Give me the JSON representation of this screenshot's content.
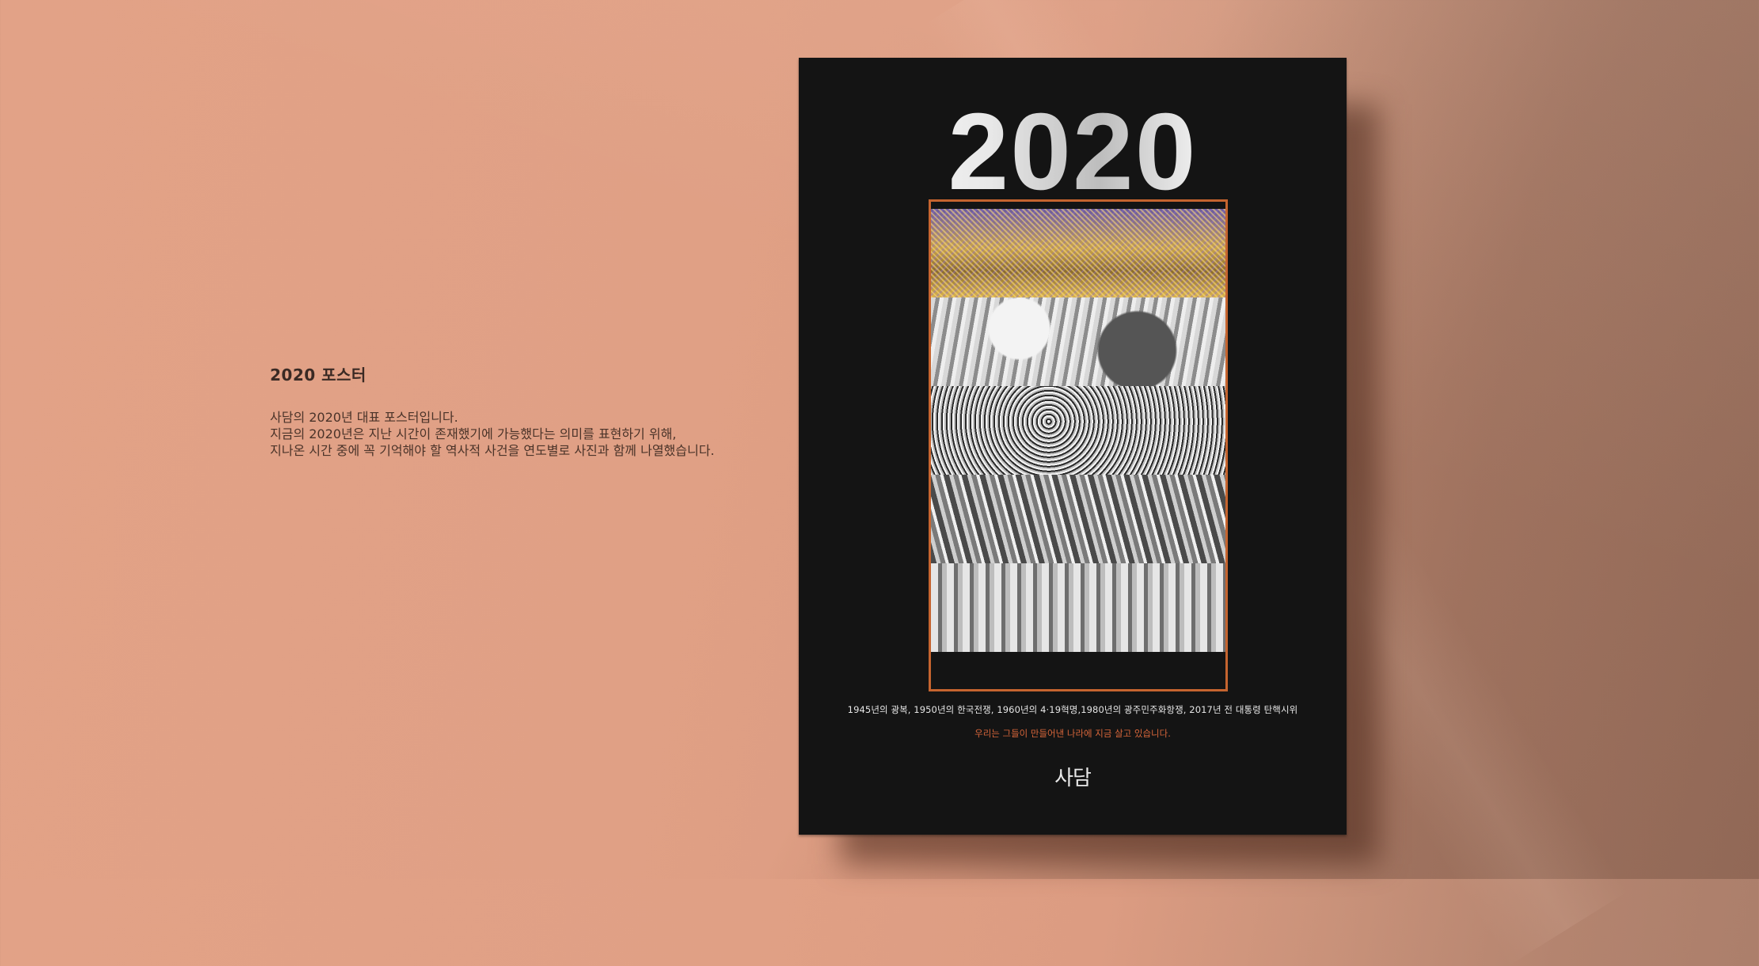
{
  "description": {
    "title": "2020 포스터",
    "lines": [
      "사담의 2020년 대표 포스터입니다.",
      "지금의 2020년은 지난 시간이 존재했기에  가능했다는 의미를 표현하기 위해,",
      "지나온 시간 중에 꼭 기억해야 할 역사적 사건을 연도별로 사진과 함께 나열했습니다."
    ]
  },
  "poster": {
    "headline_year": "2020",
    "years": [
      "2017",
      "1980",
      "1960",
      "1950",
      "1945"
    ],
    "caption": "1945년의 광복, 1950년의 한국전쟁, 1960년의 4·19혁명,1980년의 광주민주화항쟁, 2017년 전 대통령 탄핵시위",
    "subcaption": "우리는 그들이 만들어낸 나라에 지금 살고 있습니다.",
    "logo": "사담"
  },
  "colors": {
    "background": "#e2a287",
    "poster": "#141414",
    "accent": "#c5642f",
    "subcaption": "#d8663a"
  }
}
